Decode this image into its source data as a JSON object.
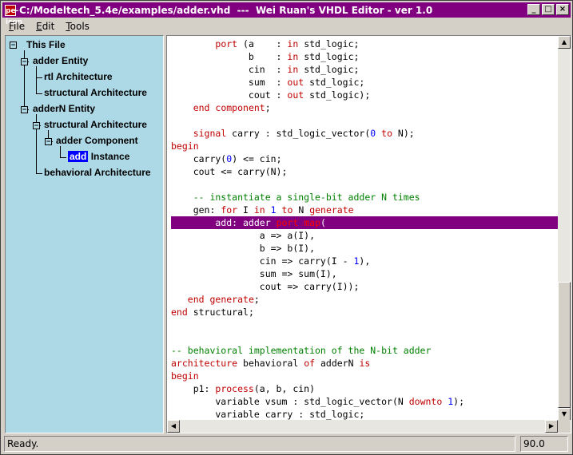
{
  "window": {
    "app_icon": "pe-icon",
    "title": "C:/Modeltech_5.4e/examples/adder.vhd  ---  Wei Ruan's VHDL Editor - ver 1.0"
  },
  "menu": [
    {
      "underline": "F",
      "rest": "ile"
    },
    {
      "underline": "E",
      "rest": "dit"
    },
    {
      "underline": "T",
      "rest": "ools"
    }
  ],
  "tree": {
    "nodes": [
      {
        "pm": "−",
        "label": "This File"
      },
      {
        "pm": "−",
        "label": "adder  Entity"
      },
      {
        "label": "rtl  Architecture"
      },
      {
        "label": "structural  Architecture"
      },
      {
        "pm": "−",
        "label": "adderN  Entity"
      },
      {
        "pm": "−",
        "label": "structural  Architecture"
      },
      {
        "pm": "−",
        "label": "adder  Component"
      },
      {
        "selected": "add",
        "label": "Instance"
      },
      {
        "label": "behavioral  Architecture"
      }
    ]
  },
  "code_lines": [
    [
      [
        "t",
        "        "
      ],
      [
        "k",
        "port"
      ],
      [
        "t",
        " (a    : "
      ],
      [
        "k",
        "in"
      ],
      [
        "t",
        " std_logic;"
      ]
    ],
    [
      [
        "t",
        "              b    : "
      ],
      [
        "k",
        "in"
      ],
      [
        "t",
        " std_logic;"
      ]
    ],
    [
      [
        "t",
        "              cin  : "
      ],
      [
        "k",
        "in"
      ],
      [
        "t",
        " std_logic;"
      ]
    ],
    [
      [
        "t",
        "              sum  : "
      ],
      [
        "k",
        "out"
      ],
      [
        "t",
        " std_logic;"
      ]
    ],
    [
      [
        "t",
        "              cout : "
      ],
      [
        "k",
        "out"
      ],
      [
        "t",
        " std_logic);"
      ]
    ],
    [
      [
        "t",
        "    "
      ],
      [
        "k",
        "end component"
      ],
      [
        "t",
        ";"
      ]
    ],
    [
      [
        "t",
        ""
      ]
    ],
    [
      [
        "t",
        "    "
      ],
      [
        "k",
        "signal"
      ],
      [
        "t",
        " carry : std_logic_vector("
      ],
      [
        "n",
        "0"
      ],
      [
        "t",
        " "
      ],
      [
        "k",
        "to"
      ],
      [
        "t",
        " N);"
      ]
    ],
    [
      [
        "k",
        "begin"
      ]
    ],
    [
      [
        "t",
        "    carry("
      ],
      [
        "n",
        "0"
      ],
      [
        "t",
        ") <= cin;"
      ]
    ],
    [
      [
        "t",
        "    cout <= carry(N);"
      ]
    ],
    [
      [
        "t",
        ""
      ]
    ],
    [
      [
        "c",
        "    -- instantiate a single-bit adder N times"
      ]
    ],
    [
      [
        "t",
        "    gen: "
      ],
      [
        "k",
        "for"
      ],
      [
        "t",
        " I "
      ],
      [
        "k",
        "in"
      ],
      [
        "t",
        " "
      ],
      [
        "n",
        "1"
      ],
      [
        "t",
        " "
      ],
      [
        "k",
        "to"
      ],
      [
        "t",
        " N "
      ],
      [
        "k",
        "generate"
      ]
    ],
    [
      [
        "t",
        "        add: adder "
      ],
      [
        "k",
        "port map"
      ],
      [
        "t",
        "("
      ]
    ],
    [
      [
        "t",
        "                a => a(I),"
      ]
    ],
    [
      [
        "t",
        "                b => b(I),"
      ]
    ],
    [
      [
        "t",
        "                cin => carry(I - "
      ],
      [
        "n",
        "1"
      ],
      [
        "t",
        "),"
      ]
    ],
    [
      [
        "t",
        "                sum => sum(I),"
      ]
    ],
    [
      [
        "t",
        "                cout => carry(I));"
      ]
    ],
    [
      [
        "t",
        "   "
      ],
      [
        "k",
        "end generate"
      ],
      [
        "t",
        ";"
      ]
    ],
    [
      [
        "k",
        "end"
      ],
      [
        "t",
        " structural;"
      ]
    ],
    [
      [
        "t",
        ""
      ]
    ],
    [
      [
        "t",
        ""
      ]
    ],
    [
      [
        "c",
        "-- behavioral implementation of the N-bit adder"
      ]
    ],
    [
      [
        "k",
        "architecture"
      ],
      [
        "t",
        " behavioral "
      ],
      [
        "k",
        "of"
      ],
      [
        "t",
        " adderN "
      ],
      [
        "k",
        "is"
      ]
    ],
    [
      [
        "k",
        "begin"
      ]
    ],
    [
      [
        "t",
        "    p1: "
      ],
      [
        "k",
        "process"
      ],
      [
        "t",
        "(a, b, cin)"
      ]
    ],
    [
      [
        "t",
        "        variable vsum : std_logic_vector(N "
      ],
      [
        "k",
        "downto"
      ],
      [
        "t",
        " "
      ],
      [
        "n",
        "1"
      ],
      [
        "t",
        ");"
      ]
    ],
    [
      [
        "t",
        "        variable carry : std_logic;"
      ]
    ]
  ],
  "highlighted_line": 14,
  "scroll": {
    "up": "▲",
    "down": "▼",
    "left": "◀",
    "right": "▶"
  },
  "status": {
    "message": "Ready.",
    "value": "90.0"
  }
}
